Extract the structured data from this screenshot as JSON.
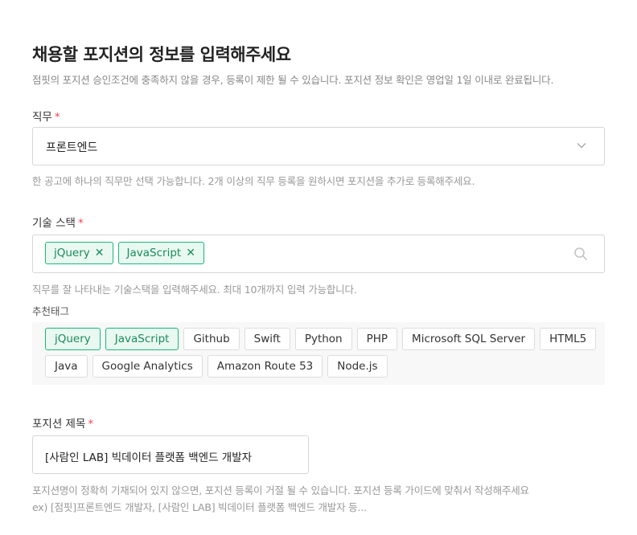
{
  "header": {
    "title": "채용할 포지션의 정보를 입력해주세요",
    "subtitle": "점핏의 포지션 승인조건에 충족하지 않을 경우, 등록이 제한 될 수 있습니다. 포지션 정보 확인은 영업일 1일 이내로 완료됩니다."
  },
  "job": {
    "label": "직무",
    "required": "*",
    "value": "프론트엔드",
    "help": "한 공고에 하나의 직무만 선택 가능합니다. 2개 이상의 직무 등록을 원하시면 포지션을 추가로 등록해주세요."
  },
  "stack": {
    "label": "기술 스택",
    "required": "*",
    "selected": [
      "jQuery",
      "JavaScript"
    ],
    "remove_glyph": "✕",
    "help": "직무를 잘 나타내는 기술스택을 입력해주세요. 최대 10개까지 입력 가능합니다."
  },
  "recommended": {
    "label": "추천태그",
    "tags": [
      {
        "label": "jQuery",
        "active": true
      },
      {
        "label": "JavaScript",
        "active": true
      },
      {
        "label": "Github",
        "active": false
      },
      {
        "label": "Swift",
        "active": false
      },
      {
        "label": "Python",
        "active": false
      },
      {
        "label": "PHP",
        "active": false
      },
      {
        "label": "Microsoft SQL Server",
        "active": false
      },
      {
        "label": "HTML5",
        "active": false
      },
      {
        "label": "Java",
        "active": false
      },
      {
        "label": "Google Analytics",
        "active": false
      },
      {
        "label": "Amazon Route 53",
        "active": false
      },
      {
        "label": "Node.js",
        "active": false
      }
    ]
  },
  "position": {
    "label": "포지션 제목",
    "required": "*",
    "value": "[사람인 LAB] 빅데이터 플랫폼 백엔드 개발자",
    "help1": "포지션명이 정확히 기재되어 있지 않으면, 포지션 등록이 거절 될 수 있습니다. 포지션 등록 가이드에 맞춰서 작성해주세요",
    "help2": "ex) [점핏]프론트엔드 개발자, [사람인 LAB] 빅데이터 플랫폼 백엔드 개발자 등..."
  },
  "colors": {
    "accent": "#17b978",
    "required": "#f04452"
  },
  "icons": {
    "select": "chevron-down-icon",
    "stack_search": "search-icon",
    "remove": "close-icon"
  }
}
